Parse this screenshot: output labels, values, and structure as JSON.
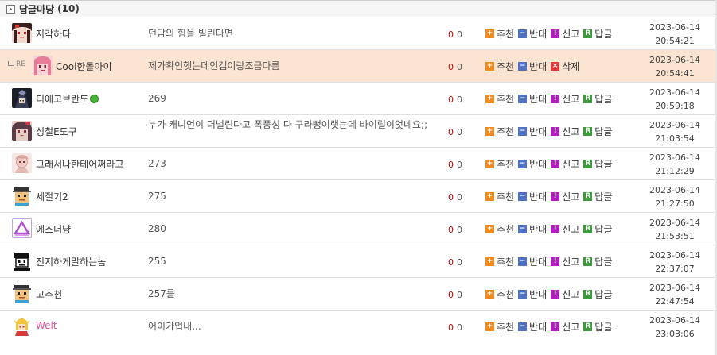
{
  "header": {
    "title": "답글마당",
    "count": "(10)"
  },
  "actions": {
    "up": "추천",
    "down": "반대",
    "report": "신고",
    "reply": "답글",
    "delete": "삭제"
  },
  "icons": {
    "up": "+",
    "down": "−",
    "report": "!",
    "reply": "R",
    "delete": "×"
  },
  "re_label": "RE",
  "comments": [
    {
      "nick": "지각하다",
      "content": "던담의 힘을 빌린다면",
      "up": "0",
      "down": "0",
      "date": "2023-06-14",
      "time": "20:54:21",
      "avatar": "avatar-girl-red"
    },
    {
      "nick": "Cool한돌아이",
      "content": "제가확인햇는데인겜이랑조금다름",
      "up": "0",
      "down": "0",
      "date": "2023-06-14",
      "time": "20:54:41",
      "avatar": "avatar-pink-hair",
      "reply": true
    },
    {
      "nick": "디에고브란도",
      "content": "269",
      "up": "0",
      "down": "0",
      "date": "2023-06-14",
      "time": "20:59:18",
      "avatar": "avatar-dark-character",
      "online": true
    },
    {
      "nick": "성철E도구",
      "content": "누가 캐니언이 더벌린다고 폭풍성 다 구라뻥이랫는데 바이럴이엇네요;;",
      "up": "0",
      "down": "0",
      "date": "2023-06-14",
      "time": "21:03:54",
      "avatar": "avatar-anime-girl"
    },
    {
      "nick": "그래서나한테어쩌라고",
      "content": "273",
      "up": "0",
      "down": "0",
      "date": "2023-06-14",
      "time": "21:12:29",
      "avatar": "avatar-sketch"
    },
    {
      "nick": "세절기2",
      "content": "275",
      "up": "0",
      "down": "0",
      "date": "2023-06-14",
      "time": "21:27:50",
      "avatar": "avatar-pixel-face"
    },
    {
      "nick": "에스더냥",
      "content": "280",
      "up": "0",
      "down": "0",
      "date": "2023-06-14",
      "time": "21:53:51",
      "avatar": "avatar-triangle"
    },
    {
      "nick": "진지하게말하는놈",
      "content": "255",
      "up": "0",
      "down": "0",
      "date": "2023-06-14",
      "time": "22:37:07",
      "avatar": "avatar-black-white"
    },
    {
      "nick": "고추천",
      "content": "257를",
      "up": "0",
      "down": "0",
      "date": "2023-06-14",
      "time": "22:47:54",
      "avatar": "avatar-pixel-face"
    },
    {
      "nick": "Welt",
      "content": "어이가업내...",
      "up": "0",
      "down": "0",
      "date": "2023-06-14",
      "time": "23:03:06",
      "avatar": "avatar-chibi",
      "pink": true
    }
  ]
}
